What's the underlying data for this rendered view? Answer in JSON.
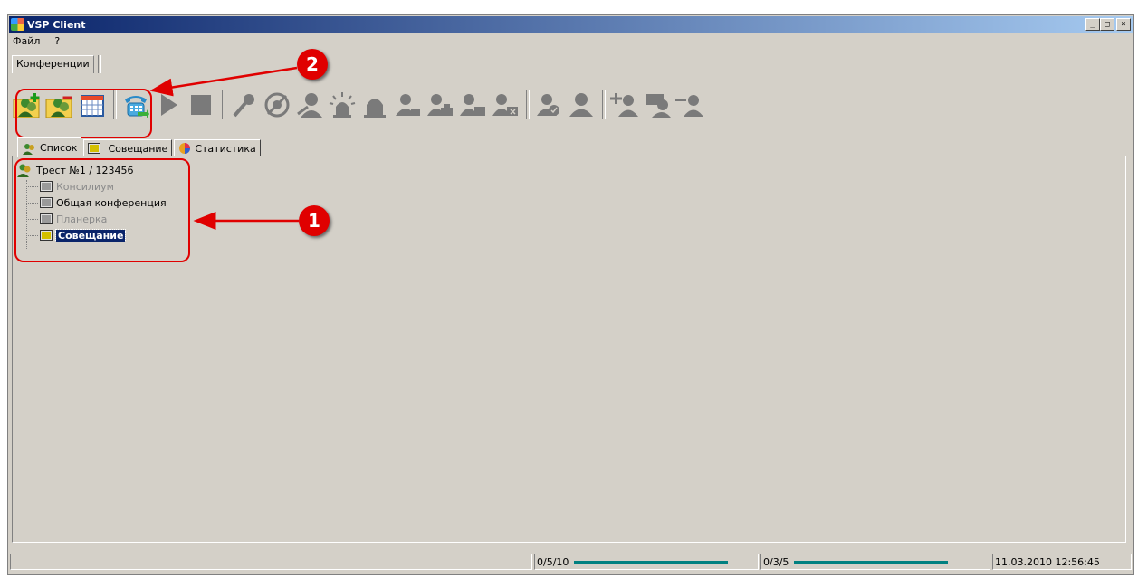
{
  "window": {
    "title": "VSP Client",
    "minimize": "_",
    "maximize": "□",
    "close": "×"
  },
  "menu": [
    "Файл",
    "?"
  ],
  "topnav": {
    "tab": "Конференции"
  },
  "tabs": [
    "Список",
    "Совещание",
    "Статистика"
  ],
  "tree": {
    "root": "Трест №1 / 123456",
    "children": [
      {
        "label": "Консилиум",
        "state": "disabled"
      },
      {
        "label": "Общая конференция",
        "state": "normal"
      },
      {
        "label": "Планерка",
        "state": "disabled"
      },
      {
        "label": "Совещание",
        "state": "selected"
      }
    ]
  },
  "status": {
    "counter1": "0/5/10",
    "progress1": 1.0,
    "counter2": "0/3/5",
    "progress2": 1.0,
    "datetime": "11.03.2010 12:56:45"
  },
  "annotations": {
    "marker1": "1",
    "marker2": "2",
    "color": "#e00000"
  },
  "colors": {
    "titlebar_start": "#0a246a",
    "titlebar_end": "#a6caf0",
    "window_bg": "#d4d0c8",
    "progress": "#008080"
  },
  "toolbar_icons": [
    "add-conference-icon",
    "remove-conference-icon",
    "schedule-icon",
    "phone-icon",
    "play-icon",
    "stop-icon",
    "mute-mic-icon",
    "no-video-icon",
    "mute-participant-icon",
    "alarm-icon",
    "bell-icon",
    "participant-icon",
    "participant-group-icon",
    "participant-call-icon",
    "participant-remove-icon",
    "participant-check-icon",
    "participant-icon-2",
    "add-participant-icon",
    "chat-icon",
    "remove-participant-icon"
  ]
}
